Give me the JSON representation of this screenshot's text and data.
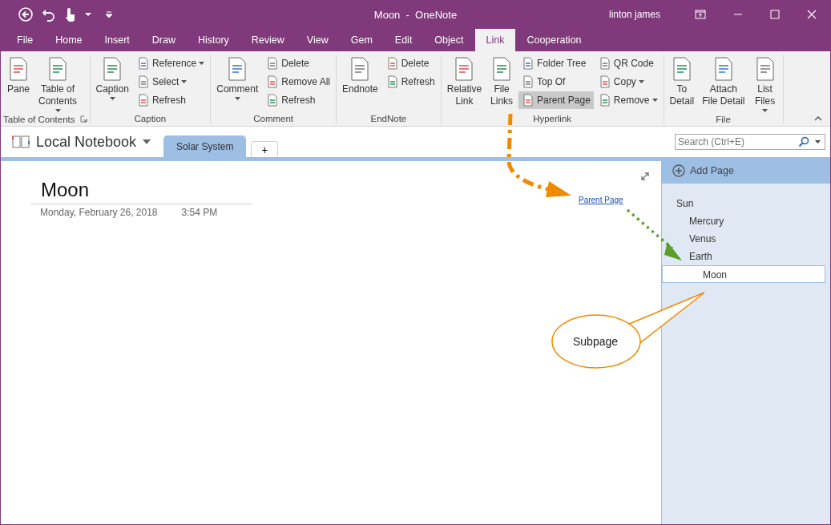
{
  "title_bar": {
    "title": "Moon  -  OneNote",
    "user": "linton james"
  },
  "tabs": [
    {
      "label": "File",
      "selected": false
    },
    {
      "label": "Home",
      "selected": false
    },
    {
      "label": "Insert",
      "selected": false
    },
    {
      "label": "Draw",
      "selected": false
    },
    {
      "label": "History",
      "selected": false
    },
    {
      "label": "Review",
      "selected": false
    },
    {
      "label": "View",
      "selected": false
    },
    {
      "label": "Gem",
      "selected": false
    },
    {
      "label": "Edit",
      "selected": false
    },
    {
      "label": "Object",
      "selected": false
    },
    {
      "label": "Link",
      "selected": true
    },
    {
      "label": "Cooperation",
      "selected": false
    }
  ],
  "ribbon": {
    "groups": [
      {
        "label": "Table of Contents",
        "launcher": true,
        "columns": [
          {
            "kind": "large",
            "label": "Pane",
            "dropdown": false
          },
          {
            "kind": "large",
            "label": "Table of\nContents",
            "dropdown": true
          }
        ]
      },
      {
        "label": "Caption",
        "columns": [
          {
            "kind": "large",
            "label": "Caption",
            "dropdown": true
          },
          {
            "kind": "stack",
            "buttons": [
              {
                "label": "Reference",
                "dropdown": true,
                "selected": false
              },
              {
                "label": "Select",
                "dropdown": true,
                "selected": false
              },
              {
                "label": "Refresh",
                "dropdown": false,
                "selected": false
              }
            ]
          }
        ]
      },
      {
        "label": "Comment",
        "columns": [
          {
            "kind": "large",
            "label": "Comment",
            "dropdown": true
          },
          {
            "kind": "stack",
            "buttons": [
              {
                "label": "Delete",
                "dropdown": false,
                "selected": false
              },
              {
                "label": "Remove All",
                "dropdown": false,
                "selected": false
              },
              {
                "label": "Refresh",
                "dropdown": false,
                "selected": false
              }
            ]
          }
        ]
      },
      {
        "label": "EndNote",
        "columns": [
          {
            "kind": "large",
            "label": "Endnote",
            "dropdown": false
          },
          {
            "kind": "stack",
            "buttons": [
              {
                "label": "Delete",
                "dropdown": false,
                "selected": false
              },
              {
                "label": "Refresh",
                "dropdown": false,
                "selected": false
              }
            ]
          }
        ]
      },
      {
        "label": "Hyperlink",
        "columns": [
          {
            "kind": "large",
            "label": "Relative\nLink",
            "dropdown": false
          },
          {
            "kind": "large",
            "label": "File\nLinks",
            "dropdown": false
          },
          {
            "kind": "stack",
            "buttons": [
              {
                "label": "Folder Tree",
                "dropdown": false,
                "selected": false
              },
              {
                "label": "Top Of",
                "dropdown": false,
                "selected": false
              },
              {
                "label": "Parent Page",
                "dropdown": false,
                "selected": true
              }
            ]
          },
          {
            "kind": "stack",
            "buttons": [
              {
                "label": "QR Code",
                "dropdown": false,
                "selected": false
              },
              {
                "label": "Copy",
                "dropdown": true,
                "selected": false
              },
              {
                "label": "Remove",
                "dropdown": true,
                "selected": false
              }
            ]
          }
        ]
      },
      {
        "label": "File",
        "columns": [
          {
            "kind": "large",
            "label": "To\nDetail",
            "dropdown": false
          },
          {
            "kind": "large",
            "label": "Attach\nFile Detail",
            "dropdown": false
          },
          {
            "kind": "large",
            "label": "List\nFiles",
            "dropdown": true
          }
        ]
      }
    ]
  },
  "notebook": {
    "name": "Local Notebook",
    "sections": [
      {
        "label": "Solar System",
        "selected": true
      }
    ],
    "add_section": "+"
  },
  "search": {
    "placeholder": "Search (Ctrl+E)"
  },
  "page": {
    "title": "Moon",
    "date": "Monday, February 26, 2018",
    "time": "3:54 PM",
    "link": "Parent Page"
  },
  "page_list": {
    "add_page": "Add Page",
    "pages": [
      {
        "title": "Sun",
        "selected": false,
        "children": [
          {
            "title": "Mercury",
            "selected": false
          },
          {
            "title": "Venus",
            "selected": false
          },
          {
            "title": "Earth",
            "selected": false,
            "children": [
              {
                "title": "Moon",
                "selected": true
              }
            ]
          }
        ]
      }
    ]
  },
  "callout": {
    "text": "Subpage"
  }
}
